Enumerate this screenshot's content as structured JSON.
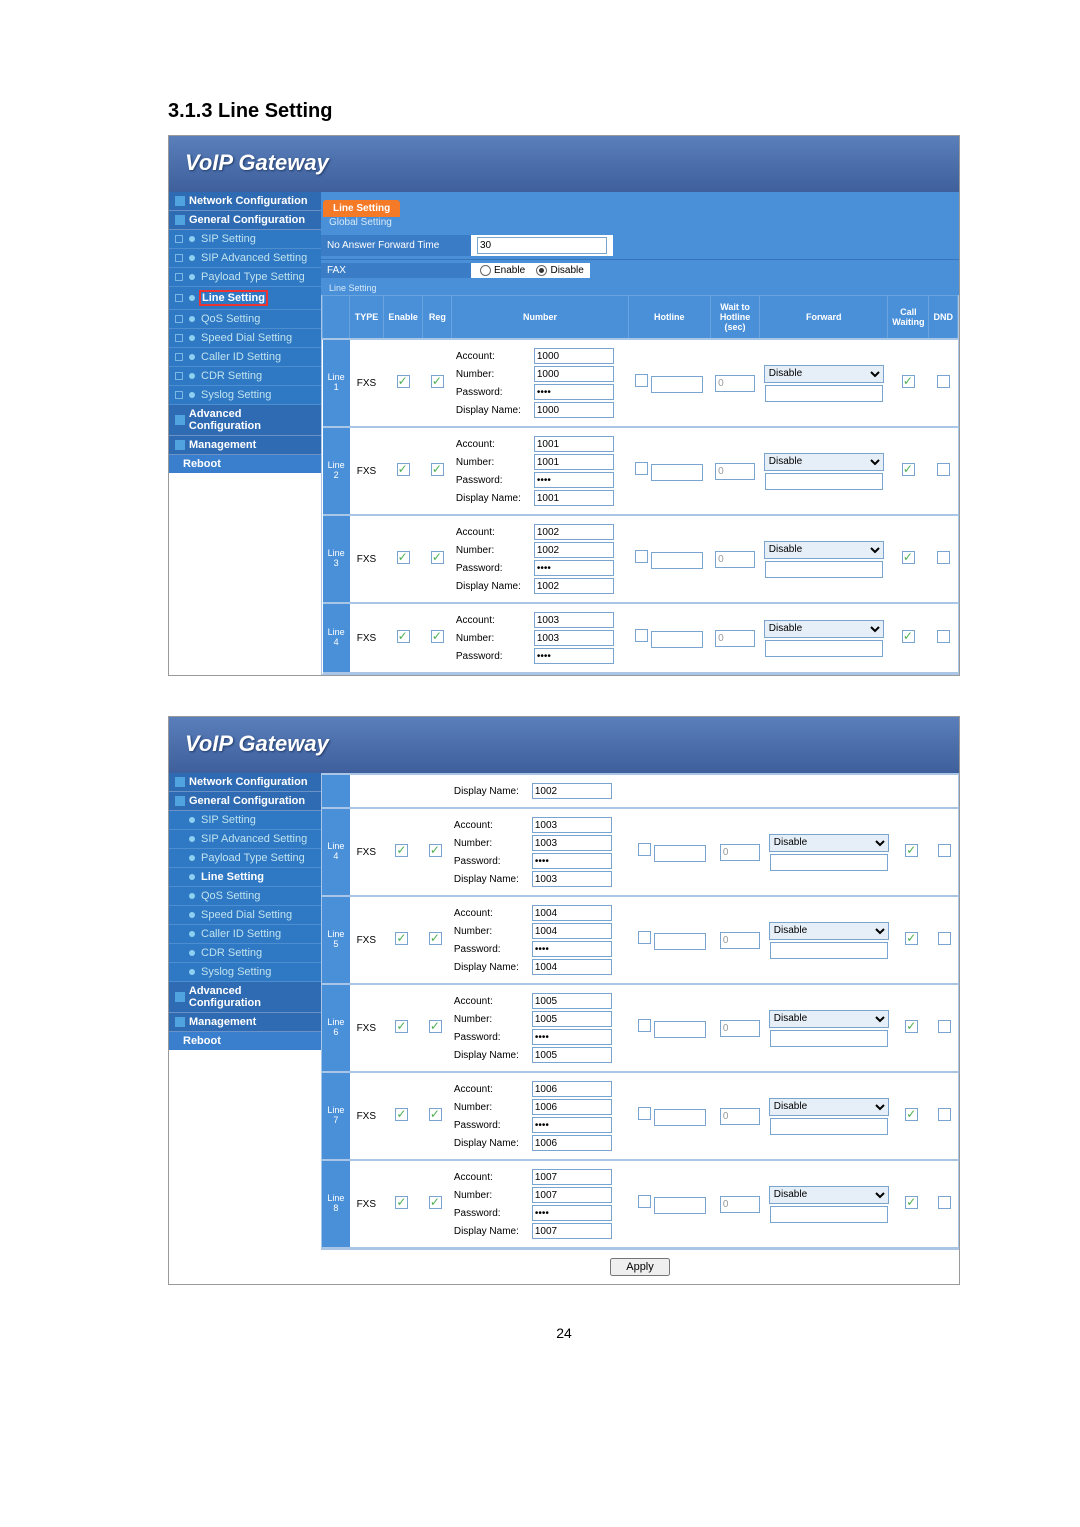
{
  "doc": {
    "heading": "3.1.3  Line Setting",
    "page_number": "24"
  },
  "banner_title": "VoIP  Gateway",
  "nav1": {
    "network": "Network Configuration",
    "general": "General Configuration",
    "sip": "SIP Setting",
    "sip_adv": "SIP Advanced Setting",
    "payload": "Payload Type Setting",
    "line": "Line Setting",
    "qos": "QoS Setting",
    "speed": "Speed Dial Setting",
    "caller": "Caller ID Setting",
    "cdr": "CDR Setting",
    "syslog": "Syslog Setting",
    "adv": "Advanced Configuration",
    "mgmt": "Management",
    "reboot": "Reboot"
  },
  "tabs": {
    "line_setting": "Line Setting"
  },
  "global": {
    "section_label": "Global Setting",
    "noanswer_label": "No Answer Forward Time",
    "noanswer_value": "30",
    "fax_label": "FAX",
    "fax_enable": "Enable",
    "fax_disable": "Disable",
    "fax_selected": "disable",
    "line_setting_label": "Line Setting"
  },
  "thead": {
    "type": "TYPE",
    "enable": "Enable",
    "reg": "Reg",
    "number": "Number",
    "hotline": "Hotline",
    "wait": "Wait to Hotline (sec)",
    "forward": "Forward",
    "cw": "Call Waiting",
    "dnd": "DND"
  },
  "fields": {
    "account": "Account:",
    "number": "Number:",
    "password": "Password:",
    "display": "Display Name:"
  },
  "lines1": [
    {
      "id": "Line 1",
      "type": "FXS",
      "enable": true,
      "reg": true,
      "account": "1000",
      "number": "1000",
      "password": "••••",
      "display": "1000",
      "hotline": false,
      "wait": "0",
      "forward": "Disable",
      "cw": true,
      "dnd": false
    },
    {
      "id": "Line 2",
      "type": "FXS",
      "enable": true,
      "reg": true,
      "account": "1001",
      "number": "1001",
      "password": "••••",
      "display": "1001",
      "hotline": false,
      "wait": "0",
      "forward": "Disable",
      "cw": true,
      "dnd": false
    },
    {
      "id": "Line 3",
      "type": "FXS",
      "enable": true,
      "reg": true,
      "account": "1002",
      "number": "1002",
      "password": "••••",
      "display": "1002",
      "hotline": false,
      "wait": "0",
      "forward": "Disable",
      "cw": true,
      "dnd": false
    },
    {
      "id": "Line 4",
      "type": "FXS",
      "enable": true,
      "reg": true,
      "account": "1003",
      "number": "1003",
      "password": "••••",
      "display": "",
      "hotline": false,
      "wait": "0",
      "forward": "Disable",
      "cw": true,
      "dnd": false
    }
  ],
  "spill": {
    "display_label": "Display Name:",
    "display_value": "1002"
  },
  "lines2": [
    {
      "id": "Line 4",
      "type": "FXS",
      "enable": true,
      "reg": true,
      "account": "1003",
      "number": "1003",
      "password": "••••",
      "display": "1003",
      "hotline": false,
      "wait": "0",
      "forward": "Disable",
      "cw": true,
      "dnd": false
    },
    {
      "id": "Line 5",
      "type": "FXS",
      "enable": true,
      "reg": true,
      "account": "1004",
      "number": "1004",
      "password": "••••",
      "display": "1004",
      "hotline": false,
      "wait": "0",
      "forward": "Disable",
      "cw": true,
      "dnd": false
    },
    {
      "id": "Line 6",
      "type": "FXS",
      "enable": true,
      "reg": true,
      "account": "1005",
      "number": "1005",
      "password": "••••",
      "display": "1005",
      "hotline": false,
      "wait": "0",
      "forward": "Disable",
      "cw": true,
      "dnd": false
    },
    {
      "id": "Line 7",
      "type": "FXS",
      "enable": true,
      "reg": true,
      "account": "1006",
      "number": "1006",
      "password": "••••",
      "display": "1006",
      "hotline": false,
      "wait": "0",
      "forward": "Disable",
      "cw": true,
      "dnd": false
    },
    {
      "id": "Line 8",
      "type": "FXS",
      "enable": true,
      "reg": true,
      "account": "1007",
      "number": "1007",
      "password": "••••",
      "display": "1007",
      "hotline": false,
      "wait": "0",
      "forward": "Disable",
      "cw": true,
      "dnd": false
    }
  ],
  "apply": "Apply"
}
